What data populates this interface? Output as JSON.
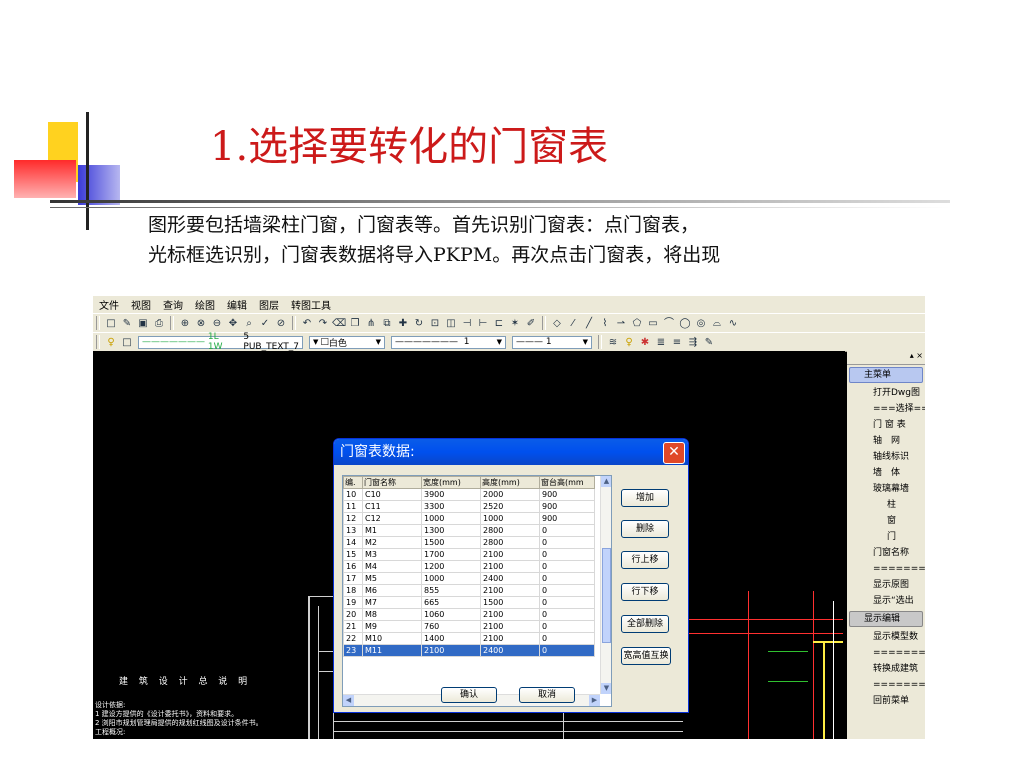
{
  "slide": {
    "title": "1.选择要转化的门窗表",
    "body_line1": "图形要包括墙梁柱门窗，门窗表等。首先识别门窗表：点门窗表，",
    "body_line2": "光标框选识别，门窗表数据将导入PKPM。再次点击门窗表，将出现"
  },
  "app": {
    "menu": [
      "文件",
      "视图",
      "查询",
      "绘图",
      "编辑",
      "图层",
      "转图工具"
    ],
    "layer_combo": "1L 1W",
    "text_style": "5 PUB_TEXT_7",
    "color_combo": "白色",
    "linetype_combo": "1",
    "lineweight_combo": "1"
  },
  "side_menu": {
    "main_label": "主菜单",
    "items": [
      "打开Dwg图",
      "===选择===",
      "门 窗 表",
      "轴　网",
      "轴线标识",
      "墙　体",
      "玻璃幕墙",
      "柱",
      "窗",
      "门",
      "门窗名称",
      "==========",
      "显示原图",
      "显示“选出"
    ],
    "edit_label": "显示编辑",
    "items2": [
      "显示模型数",
      "==========",
      "转换成建筑",
      "==========",
      "回前菜单"
    ]
  },
  "cad_texts": {
    "design_title": "建 筑 设 计 总 说 明",
    "note1": "设计依据:",
    "note2": "1 建设方提供的《设计委托书》，资料和要求。",
    "note3": "2 浏阳市规划管理局提供的规划红线图及设计条件书。",
    "note4": "工程概况:"
  },
  "dialog": {
    "title": "门窗表数据:",
    "columns": [
      "编.",
      "门窗名称",
      "宽度(mm)",
      "高度(mm)",
      "窗台高(mm"
    ],
    "rows": [
      [
        "10",
        "C10",
        "3900",
        "2000",
        "900"
      ],
      [
        "11",
        "C11",
        "3300",
        "2520",
        "900"
      ],
      [
        "12",
        "C12",
        "1000",
        "1000",
        "900"
      ],
      [
        "13",
        "M1",
        "1300",
        "2800",
        "0"
      ],
      [
        "14",
        "M2",
        "1500",
        "2800",
        "0"
      ],
      [
        "15",
        "M3",
        "1700",
        "2100",
        "0"
      ],
      [
        "16",
        "M4",
        "1200",
        "2100",
        "0"
      ],
      [
        "17",
        "M5",
        "1000",
        "2400",
        "0"
      ],
      [
        "18",
        "M6",
        "855",
        "2100",
        "0"
      ],
      [
        "19",
        "M7",
        "665",
        "1500",
        "0"
      ],
      [
        "20",
        "M8",
        "1060",
        "2100",
        "0"
      ],
      [
        "21",
        "M9",
        "760",
        "2100",
        "0"
      ],
      [
        "22",
        "M10",
        "1400",
        "2100",
        "0"
      ],
      [
        "23",
        "M11",
        "2100",
        "2400",
        "0"
      ]
    ],
    "selected_row": 13,
    "buttons": {
      "add": "增加",
      "delete": "删除",
      "move_up": "行上移",
      "move_down": "行下移",
      "delete_all": "全部删除",
      "swap": "宽高值互换",
      "ok": "确认",
      "cancel": "取消"
    }
  },
  "colors": {
    "title_red": "#cc1a1a",
    "selection_blue": "#316ac5",
    "xp_title_blue": "#0a5de8"
  }
}
